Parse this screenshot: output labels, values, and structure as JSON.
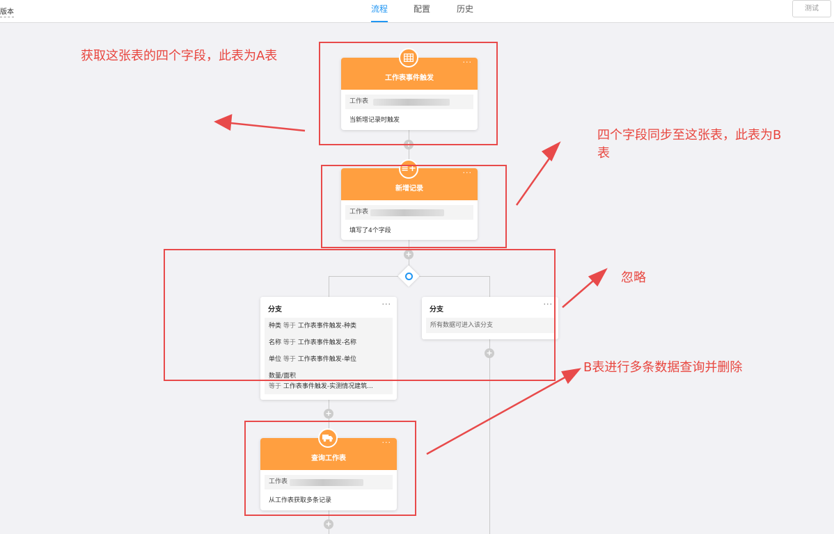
{
  "header": {
    "version_label": "版本",
    "tabs": [
      "流程",
      "配置",
      "历史"
    ],
    "test_button": "测试"
  },
  "flow": {
    "trigger": {
      "title": "工作表事件触发",
      "icon": "table-icon",
      "field_label": "工作表",
      "note": "当新增记录时触发"
    },
    "add_record": {
      "title": "新增记录",
      "icon": "add-row-icon",
      "field_label": "工作表",
      "note": "填写了4个字段"
    },
    "branch_left": {
      "title": "分支",
      "conditions": [
        {
          "field": "种类",
          "op": "等于",
          "value": "工作表事件触发-种类"
        },
        {
          "field": "名称",
          "op": "等于",
          "value": "工作表事件触发-名称"
        },
        {
          "field": "单位",
          "op": "等于",
          "value": "工作表事件触发-单位"
        },
        {
          "field": "数量/面积",
          "op": "等于",
          "value": "工作表事件触发-实测情况建筑..."
        }
      ]
    },
    "branch_right": {
      "title": "分支",
      "note": "所有数据可进入该分支"
    },
    "query": {
      "title": "查询工作表",
      "icon": "truck-icon",
      "field_label": "工作表",
      "note": "从工作表获取多条记录"
    }
  },
  "annotations": {
    "a": "获取这张表的四个字段，此表为A表",
    "b_line1": "四个字段同步至这张表，此表为B",
    "b_line2": "表",
    "ignore": "忽略",
    "delete": "B表进行多条数据查询并删除"
  },
  "colors": {
    "accent": "#2196f3",
    "node_orange": "#ff9f40",
    "annotation_red": "#e84a4a"
  }
}
